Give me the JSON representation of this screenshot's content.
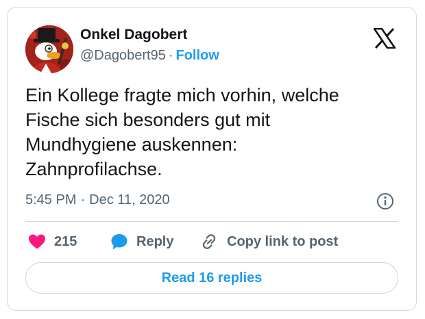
{
  "author": {
    "name": "Onkel Dagobert",
    "handle": "@Dagobert95",
    "separator": "·",
    "follow_label": "Follow",
    "avatar_icon": "avatar-cartoon-duck-icon"
  },
  "brand": {
    "logo_icon": "x-logo-icon"
  },
  "tweet": {
    "text": "Ein Kollege fragte mich vorhin, welche\nFische sich besonders gut mit\nMundhygiene auskennen:\nZahnprofilachse.",
    "time": "5:45 PM",
    "separator": "·",
    "date": "Dec 11, 2020"
  },
  "actions": {
    "like_count": "215",
    "reply_label": "Reply",
    "copy_label": "Copy link to post",
    "read_replies_label": "Read 16 replies"
  },
  "colors": {
    "accent": "#1d9bf0",
    "like": "#f91880",
    "text": "#0f1419",
    "muted": "#536471",
    "border": "#cfd9de"
  }
}
